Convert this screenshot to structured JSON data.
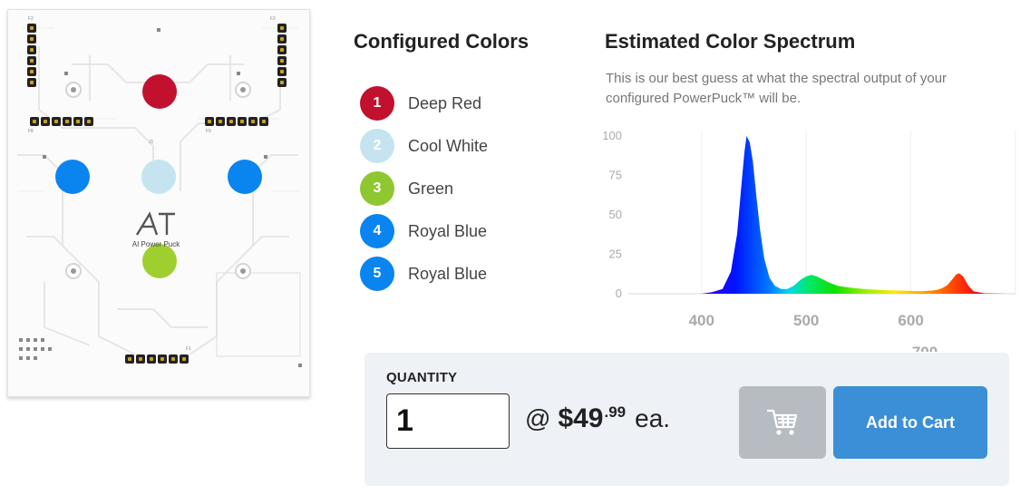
{
  "board": {
    "logo_text": "AI Power Puck",
    "leds": [
      {
        "color": "#c2112f"
      },
      {
        "color": "#c5e4ef"
      },
      {
        "color": "#9fcf2f"
      },
      {
        "color": "#0a84ef"
      },
      {
        "color": "#0a84ef"
      }
    ],
    "silk_labels": [
      "F2",
      "F3",
      "F8",
      "F9",
      "F1",
      "J1"
    ]
  },
  "configured": {
    "title": "Configured Colors",
    "items": [
      {
        "num": "1",
        "name": "Deep Red",
        "color": "#c2112f"
      },
      {
        "num": "2",
        "name": "Cool White",
        "color": "#c5e4ef"
      },
      {
        "num": "3",
        "name": "Green",
        "color": "#8fc730"
      },
      {
        "num": "4",
        "name": "Royal Blue",
        "color": "#0a84ef"
      },
      {
        "num": "5",
        "name": "Royal Blue",
        "color": "#0a84ef"
      }
    ]
  },
  "spectrum": {
    "title": "Estimated Color Spectrum",
    "description": "This is our best guess at what the spectral output of your configured PowerPuck™ will be."
  },
  "chart_data": {
    "type": "area",
    "title": "",
    "xlabel": "",
    "ylabel": "",
    "y_ticks": [
      "100",
      "75",
      "50",
      "25",
      "0"
    ],
    "x_ticks": [
      "400",
      "500",
      "600",
      "700"
    ],
    "xlim": [
      330,
      700
    ],
    "ylim": [
      0,
      100
    ],
    "grid": true,
    "series": [
      {
        "x": [
          335,
          400,
          410,
          420,
          428,
          434,
          438,
          441,
          443,
          446,
          449,
          452,
          456,
          460,
          465,
          470,
          476,
          482,
          488,
          495,
          500,
          505,
          510,
          516,
          522,
          530,
          540,
          550,
          560,
          570,
          580,
          590,
          600,
          610,
          620,
          625,
          630,
          635,
          640,
          643,
          646,
          650,
          655,
          660,
          670,
          690
        ],
        "y": [
          0,
          0,
          1,
          3,
          14,
          38,
          68,
          90,
          100,
          96,
          84,
          64,
          40,
          22,
          10,
          5,
          3,
          3,
          5,
          9,
          11,
          12,
          11,
          9,
          7,
          5,
          4,
          3.3,
          2.8,
          2.5,
          2.2,
          2,
          1.8,
          1.6,
          2,
          2.5,
          3.5,
          5.5,
          9.5,
          12,
          13,
          11,
          5,
          1.5,
          0.3,
          0
        ]
      }
    ]
  },
  "purchase": {
    "quantity_label": "QUANTITY",
    "quantity_value": "1",
    "at": "@",
    "price_dollars": "$49",
    "price_cents": ".99",
    "unit": "ea.",
    "add_to_cart_label": "Add to Cart"
  }
}
